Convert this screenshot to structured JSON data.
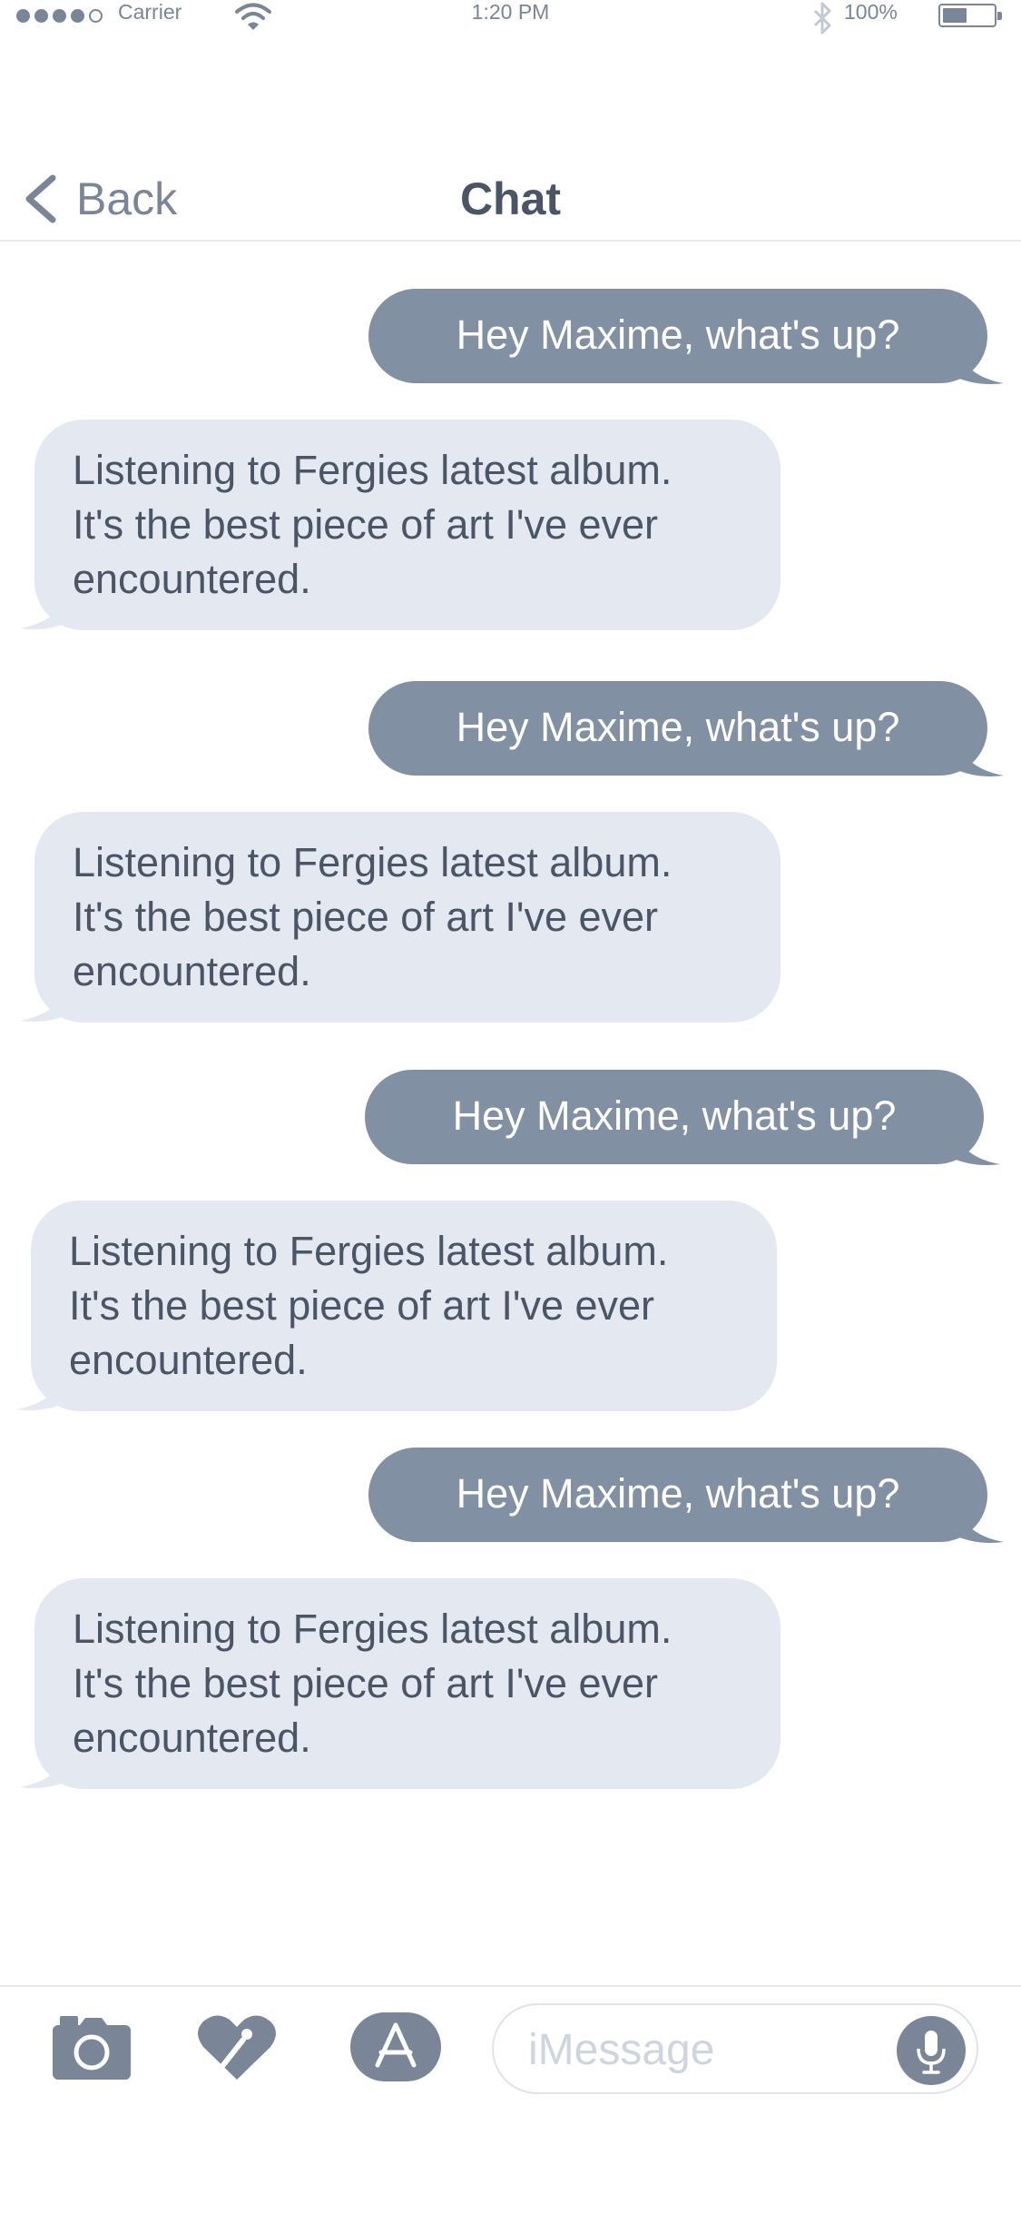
{
  "status_bar": {
    "carrier": "Carrier",
    "time": "1:20 PM",
    "battery_percent": "100%",
    "signal_bars_filled": 4,
    "signal_bars_total": 5,
    "battery_level": 0.4
  },
  "nav": {
    "back_label": "Back",
    "title": "Chat"
  },
  "messages": [
    {
      "direction": "outgoing",
      "text": "Hey Maxime, what's up?"
    },
    {
      "direction": "incoming",
      "text": "Listening to Fergies latest album.\nIt's the best piece of art I've ever\nencountered."
    },
    {
      "direction": "outgoing",
      "text": "Hey Maxime, what's up?"
    },
    {
      "direction": "incoming",
      "text": "Listening to Fergies latest album.\nIt's the best piece of art I've ever\nencountered."
    },
    {
      "direction": "outgoing",
      "text": "Hey Maxime, what's up?"
    },
    {
      "direction": "incoming",
      "text": "Listening to Fergies latest album.\nIt's the best piece of art I've ever\nencountered."
    },
    {
      "direction": "outgoing",
      "text": "Hey Maxime, what's up?"
    },
    {
      "direction": "incoming",
      "text": "Listening to Fergies latest album.\nIt's the best piece of art I've ever\nencountered."
    }
  ],
  "toolbar": {
    "icons": [
      "camera-icon",
      "digital-touch-icon",
      "app-store-icon",
      "microphone-icon"
    ],
    "message_placeholder": "iMessage"
  },
  "colors": {
    "outgoing_bubble": "#8290a3",
    "incoming_bubble": "#e4e8f1",
    "accent": "#7a8698"
  }
}
